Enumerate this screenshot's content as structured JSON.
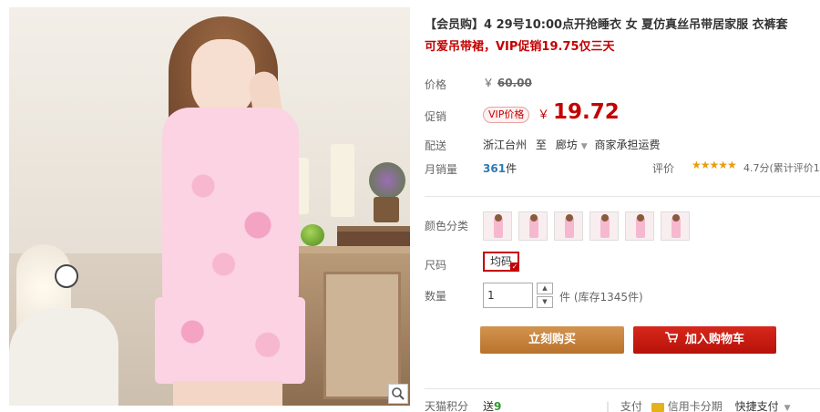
{
  "product": {
    "title": "【会员购】4 29号10:00点开抢睡衣 女 夏仿真丝吊带居家服 衣裤套",
    "subtitle": "可爱吊带裙，VIP促销19.75仅三天"
  },
  "price": {
    "label": "价格",
    "currency": "￥",
    "original": "60.00"
  },
  "promo": {
    "label": "促销",
    "tag": "VIP价格",
    "currency": "￥",
    "price": "19.72"
  },
  "shipping": {
    "label": "配送",
    "from": "浙江台州",
    "to_word": "至",
    "to": "廊坊",
    "note": "商家承担运费"
  },
  "sales": {
    "label": "月销量",
    "count": "361",
    "unit": "件"
  },
  "rating": {
    "label": "评价",
    "stars": "★★★★★",
    "score": "4.7分(累计评价1"
  },
  "options": {
    "color_label": "颜色分类",
    "swatch_count": 6,
    "size_label": "尺码",
    "size_value": "均码",
    "qty_label": "数量",
    "qty_value": "1",
    "stock_text": "件 (库存1345件)"
  },
  "actions": {
    "buy": "立刻购买",
    "cart": "加入购物车"
  },
  "footer": {
    "tmall_label": "天猫积分",
    "tmall_prefix": "送",
    "tmall_points": "9",
    "pay_label": "支付",
    "card_label": "信用卡分期",
    "more_label": "快捷支付"
  },
  "icons": {
    "zoom": "magnifier-icon",
    "cart": "cart-icon",
    "card": "credit-card-icon"
  },
  "colors": {
    "accent_red": "#c40000",
    "buy_button": "#c7853f",
    "cart_button": "#c8190f"
  }
}
